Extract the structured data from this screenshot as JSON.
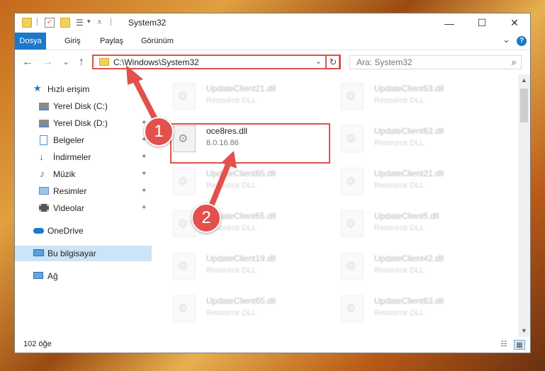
{
  "window": {
    "title": "System32",
    "controls": {
      "minimize": "—",
      "maximize": "☐",
      "close": "✕"
    }
  },
  "ribbon": {
    "tabs": [
      "Dosya",
      "Giriş",
      "Paylaş",
      "Görünüm"
    ],
    "help_icon": "?",
    "expand_icon": "⌄"
  },
  "navigation": {
    "back": "←",
    "forward": "→",
    "recent": "⌄",
    "up": "↑",
    "address": "C:\\Windows\\System32",
    "address_dropdown": "⌄",
    "refresh": "↻",
    "search_placeholder": "Ara: System32",
    "search_icon": "⌕"
  },
  "sidebar": {
    "items": [
      {
        "label": "Hızlı erişim",
        "icon": "star-icon",
        "pinned": false
      },
      {
        "label": "Yerel Disk (C:)",
        "icon": "drive-icon",
        "pinned": true
      },
      {
        "label": "Yerel Disk (D:)",
        "icon": "drive-icon",
        "pinned": true
      },
      {
        "label": "Belgeler",
        "icon": "documents-icon",
        "pinned": true
      },
      {
        "label": "İndirmeler",
        "icon": "download-icon",
        "pinned": true
      },
      {
        "label": "Müzik",
        "icon": "music-icon",
        "pinned": true
      },
      {
        "label": "Resimler",
        "icon": "pictures-icon",
        "pinned": true
      },
      {
        "label": "Videolar",
        "icon": "videos-icon",
        "pinned": true
      },
      {
        "label": "OneDrive",
        "icon": "cloud-icon",
        "pinned": false
      },
      {
        "label": "Bu bilgisayar",
        "icon": "computer-icon",
        "pinned": false,
        "selected": true
      },
      {
        "label": "Ağ",
        "icon": "network-icon",
        "pinned": false
      }
    ],
    "pin_glyph": "📌"
  },
  "files": {
    "highlighted": {
      "name": "oce8res.dll",
      "subtitle": "8.0.16.86"
    },
    "left_column": [
      {
        "name": "UpdateClient21.dll",
        "subtitle": "Resource DLL"
      },
      {
        "name": "UpdateClient65.dll",
        "subtitle": "Resource DLL"
      },
      {
        "name": "UpdateClient65.dll",
        "subtitle": "Resource DLL"
      },
      {
        "name": "UpdateClient19.dll",
        "subtitle": "Resource DLL"
      },
      {
        "name": "UpdateClient65.dll",
        "subtitle": "Resource DLL"
      }
    ],
    "right_column": [
      {
        "name": "UpdateClient63.dll",
        "subtitle": "Resource DLL"
      },
      {
        "name": "UpdateClient63.dll",
        "subtitle": "Resource DLL"
      },
      {
        "name": "UpdateClient21.dll",
        "subtitle": "Resource DLL"
      },
      {
        "name": "UpdateClient5.dll",
        "subtitle": "Resource DLL"
      },
      {
        "name": "UpdateClient42.dll",
        "subtitle": "Resource DLL"
      },
      {
        "name": "UpdateClient63.dll",
        "subtitle": "Resource DLL"
      }
    ]
  },
  "annotations": {
    "badge1": "1",
    "badge2": "2",
    "color": "#e2514c"
  },
  "status": {
    "count": "102 öğe"
  },
  "colors": {
    "accent": "#1979ca",
    "highlight": "#d9534f",
    "selection": "#cce4f7"
  }
}
